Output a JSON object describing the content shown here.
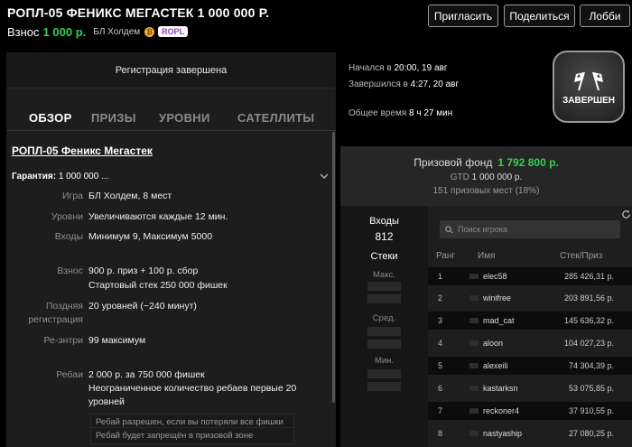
{
  "header": {
    "title": "РОПЛ-05 ФЕНИКС МЕГАСТЕК 1 000 000 Р.",
    "fee_label": "Взнос",
    "fee_amount": "1 000 р.",
    "game_type": "БЛ Холдем",
    "coin_symbol": "₿",
    "badge": "ROPL",
    "buttons": {
      "invite": "Пригласить",
      "share": "Поделиться",
      "lobby": "Лобби"
    }
  },
  "left": {
    "registration_status": "Регистрация завершена",
    "tabs": [
      "ОБЗОР",
      "ПРИЗЫ",
      "УРОВНИ",
      "САТЕЛЛИТЫ"
    ],
    "tournament_name": "РОПЛ-05 Феникс Мегастек",
    "guarantee_label": "Гарантия:",
    "guarantee_value": "1 000 000 ...",
    "details": [
      {
        "label": "Игра",
        "value": "БЛ Холдем, 8 мест"
      },
      {
        "label": "Уровни",
        "value": "Увеличиваются каждые 12 мин."
      },
      {
        "label": "Входы",
        "value": "Минимум 9, Максимум 5000"
      },
      {
        "label": "Взнос",
        "value": "900 р. приз + 100 р. сбор",
        "value2": "Стартовый стек 250 000 фишек"
      },
      {
        "label": "Поздняя",
        "label2": "регистрация",
        "value": "20 уровней (~240 минут)"
      },
      {
        "label": "Ре-энтри",
        "value": "99 максимум"
      },
      {
        "label": "Ребаи",
        "value": "2 000 р. за 750 000 фишек",
        "value2": "Неограниченное количество ребаев первые 20",
        "value3": "уровней"
      }
    ],
    "notes": [
      "Ребай разрешен, если вы потеряли все фишки",
      "Ребай будет запрещён в призовой зоне"
    ]
  },
  "times": {
    "started_label": "Начался в",
    "started_value": "20:00, 19 авг",
    "ended_label": "Завершился в",
    "ended_value": "4:27, 20 авг",
    "total_label": "Общее время",
    "total_value": "8 ч 27 мин"
  },
  "status_badge": "ЗАВЕРШЕН",
  "prize": {
    "pool_label": "Призовой фонд",
    "pool_value": "1 792 800 р.",
    "gtd_label": "GTD",
    "gtd_value": "1 000 000 р.",
    "places": "151 призовых мест (18%)"
  },
  "stats": {
    "entries_label": "Входы",
    "entries_value": "812",
    "stacks_label": "Стеки",
    "max_label": "Макс.",
    "avg_label": "Сред.",
    "min_label": "Мин."
  },
  "players": {
    "search_placeholder": "Поиск игрока",
    "columns": {
      "rank": "Ранг",
      "name": "Имя",
      "stack": "Стек/Приз"
    },
    "rows": [
      {
        "rank": "1",
        "name": "elec58",
        "prize": "285 426,31 р."
      },
      {
        "rank": "2",
        "name": "winifree",
        "prize": "203 891,56 р."
      },
      {
        "rank": "3",
        "name": "mad_cat",
        "prize": "145 636,32 р."
      },
      {
        "rank": "4",
        "name": "aloon",
        "prize": "104 027,23 р."
      },
      {
        "rank": "5",
        "name": "alexeili",
        "prize": "74 304,39 р."
      },
      {
        "rank": "6",
        "name": "kastarksn",
        "prize": "53 075,85 р."
      },
      {
        "rank": "7",
        "name": "reckoner4",
        "prize": "37 910,55 р."
      },
      {
        "rank": "8",
        "name": "nastyaship",
        "prize": "27 080,25 р."
      }
    ]
  }
}
